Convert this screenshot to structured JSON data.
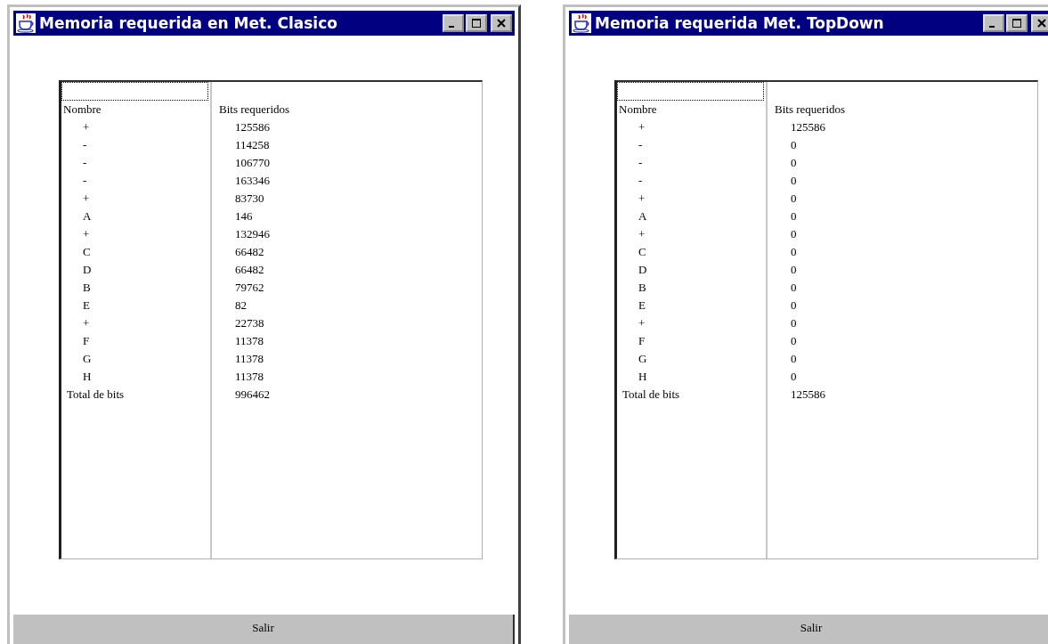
{
  "windows": [
    {
      "title": "Memoria requerida en Met. Clasico",
      "table": {
        "columns": [
          "Nombre",
          "Bits requeridos"
        ],
        "rows": [
          {
            "kind": "item",
            "name": "+",
            "bits": "125586"
          },
          {
            "kind": "item",
            "name": "-",
            "bits": "114258"
          },
          {
            "kind": "item",
            "name": "-",
            "bits": "106770"
          },
          {
            "kind": "item",
            "name": "-",
            "bits": "163346"
          },
          {
            "kind": "item",
            "name": "+",
            "bits": "83730"
          },
          {
            "kind": "item",
            "name": "A",
            "bits": "146"
          },
          {
            "kind": "item",
            "name": "+",
            "bits": "132946"
          },
          {
            "kind": "item",
            "name": "C",
            "bits": "66482"
          },
          {
            "kind": "item",
            "name": "D",
            "bits": "66482"
          },
          {
            "kind": "item",
            "name": "B",
            "bits": "79762"
          },
          {
            "kind": "item",
            "name": "E",
            "bits": "82"
          },
          {
            "kind": "item",
            "name": "+",
            "bits": "22738"
          },
          {
            "kind": "item",
            "name": "F",
            "bits": "11378"
          },
          {
            "kind": "item",
            "name": "G",
            "bits": "11378"
          },
          {
            "kind": "item",
            "name": "H",
            "bits": "11378"
          },
          {
            "kind": "total",
            "name": "Total de bits",
            "bits": "996462"
          }
        ]
      },
      "button": "Salir"
    },
    {
      "title": "Memoria requerida Met. TopDown",
      "table": {
        "columns": [
          "Nombre",
          "Bits requeridos"
        ],
        "rows": [
          {
            "kind": "item",
            "name": "+",
            "bits": "125586"
          },
          {
            "kind": "item",
            "name": "-",
            "bits": "0"
          },
          {
            "kind": "item",
            "name": "-",
            "bits": "0"
          },
          {
            "kind": "item",
            "name": "-",
            "bits": "0"
          },
          {
            "kind": "item",
            "name": "+",
            "bits": "0"
          },
          {
            "kind": "item",
            "name": "A",
            "bits": "0"
          },
          {
            "kind": "item",
            "name": "+",
            "bits": "0"
          },
          {
            "kind": "item",
            "name": "C",
            "bits": "0"
          },
          {
            "kind": "item",
            "name": "D",
            "bits": "0"
          },
          {
            "kind": "item",
            "name": "B",
            "bits": "0"
          },
          {
            "kind": "item",
            "name": "E",
            "bits": "0"
          },
          {
            "kind": "item",
            "name": "+",
            "bits": "0"
          },
          {
            "kind": "item",
            "name": "F",
            "bits": "0"
          },
          {
            "kind": "item",
            "name": "G",
            "bits": "0"
          },
          {
            "kind": "item",
            "name": "H",
            "bits": "0"
          },
          {
            "kind": "total",
            "name": "Total de bits",
            "bits": "125586"
          }
        ]
      },
      "button": "Salir"
    }
  ]
}
